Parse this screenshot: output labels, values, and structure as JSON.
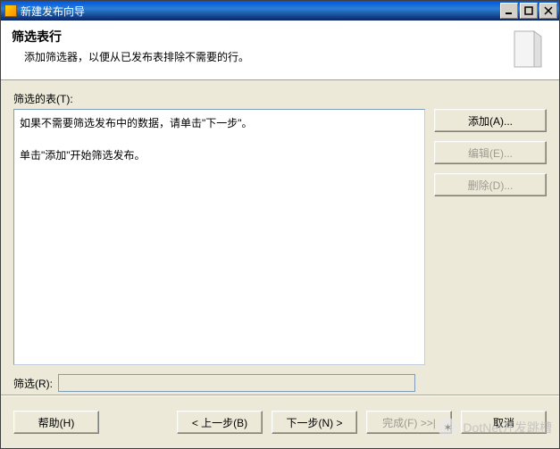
{
  "window": {
    "title": "新建发布向导"
  },
  "header": {
    "title": "筛选表行",
    "description": "添加筛选器，以便从已发布表排除不需要的行。"
  },
  "body": {
    "tables_label": "筛选的表(T):",
    "hint_line1": "如果不需要筛选发布中的数据，请单击\"下一步\"。",
    "hint_line2": "单击\"添加\"开始筛选发布。",
    "filter_label": "筛选(R):",
    "filter_value": ""
  },
  "side_buttons": {
    "add": "添加(A)...",
    "edit": "编辑(E)...",
    "delete": "删除(D)..."
  },
  "footer": {
    "help": "帮助(H)",
    "back": "< 上一步(B)",
    "next": "下一步(N) >",
    "finish": "完成(F) >>|",
    "cancel": "取消"
  },
  "watermark": {
    "text": "DotNet开发跳槽"
  }
}
